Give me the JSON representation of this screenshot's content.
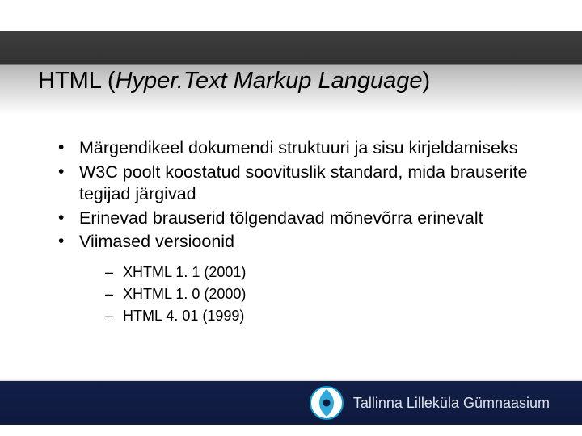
{
  "title": {
    "prefix": "HTML (",
    "italic": "Hyper.Text Markup Language",
    "suffix": ")"
  },
  "bullets": {
    "0": "Märgendikeel dokumendi struktuuri ja sisu kirjeldamiseks",
    "1": "W3C poolt koostatud soovituslik standard, mida brauserite tegijad järgivad",
    "2": "Erinevad brauserid tõlgendavad mõnevõrra erinevalt",
    "3": "Viimased versioonid"
  },
  "subbullets": {
    "0": "XHTML 1. 1 (2001)",
    "1": "XHTML 1. 0 (2000)",
    "2": "HTML 4. 01 (1999)"
  },
  "footer": {
    "org": "Tallinna Lilleküla Gümnaasium"
  },
  "colors": {
    "footer_bg": "#121f47",
    "accent": "#0a9bd6"
  }
}
